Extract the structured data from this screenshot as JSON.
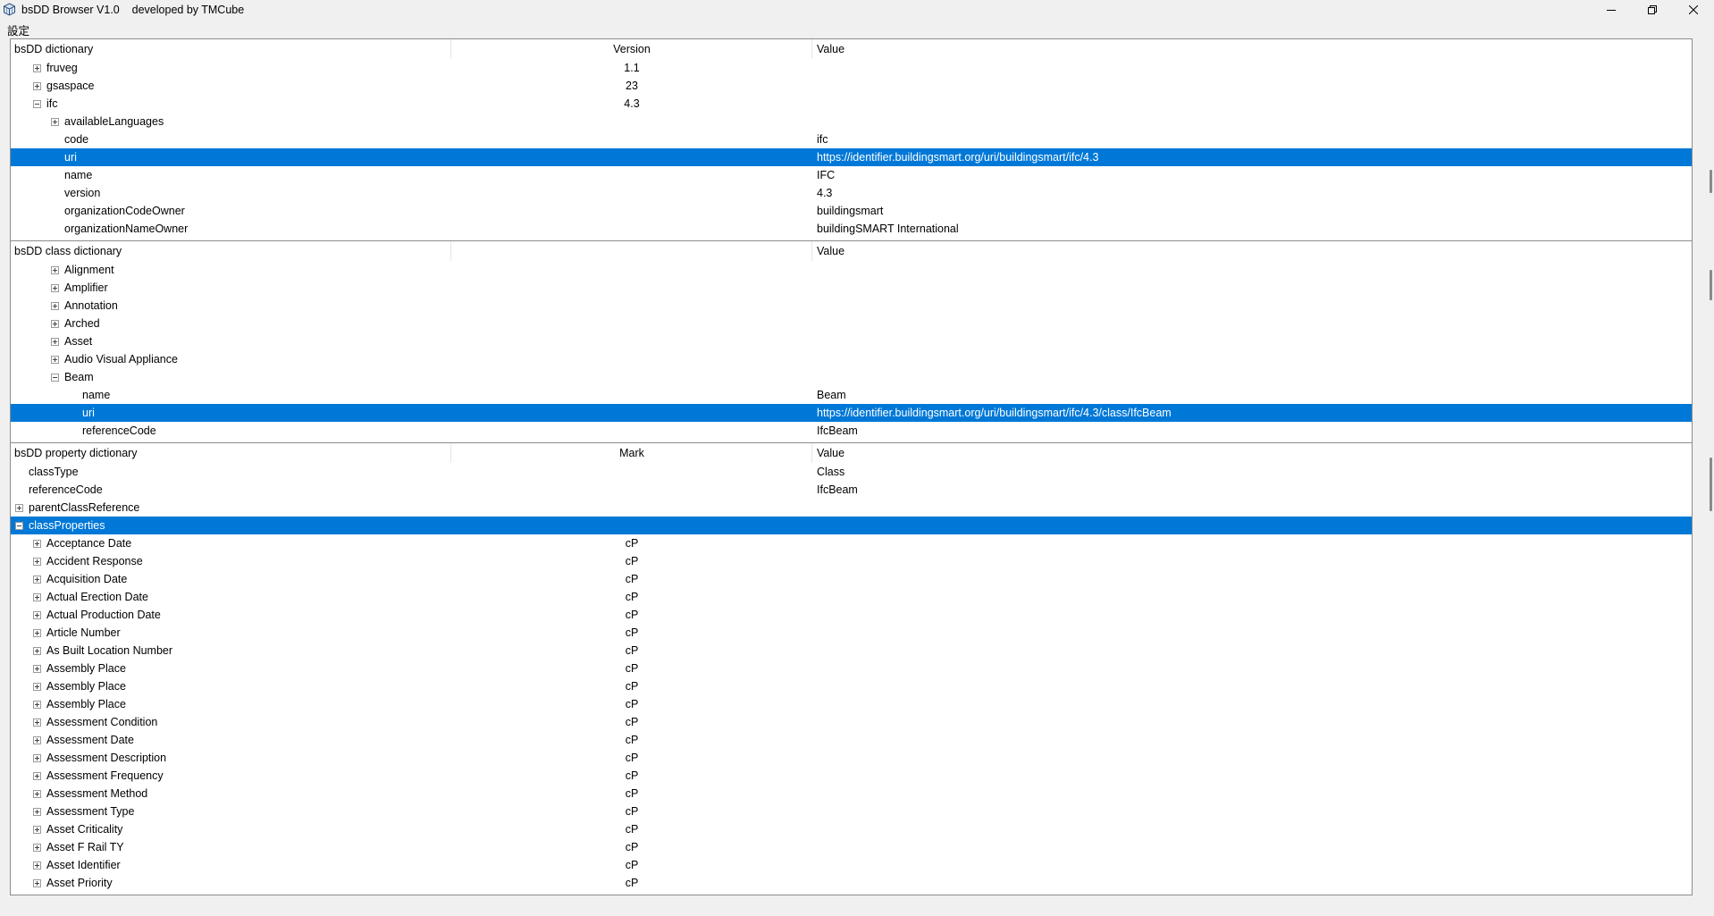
{
  "window": {
    "title": "bsDD Browser V1.0    developed by TMCube",
    "minimize": "─",
    "restore": "⧉",
    "close": "✕"
  },
  "menu": {
    "settings": "設定"
  },
  "dictionary_panel": {
    "headers": [
      "bsDD dictionary",
      "Version",
      "Value"
    ],
    "rows": [
      {
        "label": "fruveg",
        "mid": "1.1",
        "value": "",
        "level": 1,
        "expander": "plus",
        "selected": false
      },
      {
        "label": "gsaspace",
        "mid": "23",
        "value": "",
        "level": 1,
        "expander": "plus",
        "selected": false
      },
      {
        "label": "ifc",
        "mid": "4.3",
        "value": "",
        "level": 1,
        "expander": "minus",
        "selected": false
      },
      {
        "label": "availableLanguages",
        "mid": "",
        "value": "",
        "level": 2,
        "expander": "plus",
        "selected": false
      },
      {
        "label": "code",
        "mid": "",
        "value": "ifc",
        "level": 2,
        "expander": "none",
        "selected": false
      },
      {
        "label": "uri",
        "mid": "",
        "value": "https://identifier.buildingsmart.org/uri/buildingsmart/ifc/4.3",
        "level": 2,
        "expander": "none",
        "selected": true
      },
      {
        "label": "name",
        "mid": "",
        "value": "IFC",
        "level": 2,
        "expander": "none",
        "selected": false
      },
      {
        "label": "version",
        "mid": "",
        "value": "4.3",
        "level": 2,
        "expander": "none",
        "selected": false
      },
      {
        "label": "organizationCodeOwner",
        "mid": "",
        "value": "buildingsmart",
        "level": 2,
        "expander": "none",
        "selected": false
      },
      {
        "label": "organizationNameOwner",
        "mid": "",
        "value": "buildingSMART International",
        "level": 2,
        "expander": "none",
        "selected": false
      }
    ]
  },
  "class_panel": {
    "headers": [
      "bsDD class dictionary",
      "",
      "Value"
    ],
    "rows": [
      {
        "label": "Alignment",
        "mid": "",
        "value": "",
        "level": 2,
        "expander": "plus",
        "selected": false
      },
      {
        "label": "Amplifier",
        "mid": "",
        "value": "",
        "level": 2,
        "expander": "plus",
        "selected": false
      },
      {
        "label": "Annotation",
        "mid": "",
        "value": "",
        "level": 2,
        "expander": "plus",
        "selected": false
      },
      {
        "label": "Arched",
        "mid": "",
        "value": "",
        "level": 2,
        "expander": "plus",
        "selected": false
      },
      {
        "label": "Asset",
        "mid": "",
        "value": "",
        "level": 2,
        "expander": "plus",
        "selected": false
      },
      {
        "label": "Audio Visual Appliance",
        "mid": "",
        "value": "",
        "level": 2,
        "expander": "plus",
        "selected": false
      },
      {
        "label": "Beam",
        "mid": "",
        "value": "",
        "level": 2,
        "expander": "minus",
        "selected": false
      },
      {
        "label": "name",
        "mid": "",
        "value": "Beam",
        "level": 3,
        "expander": "none",
        "selected": false
      },
      {
        "label": "uri",
        "mid": "",
        "value": "https://identifier.buildingsmart.org/uri/buildingsmart/ifc/4.3/class/IfcBeam",
        "level": 3,
        "expander": "none",
        "selected": true
      },
      {
        "label": "referenceCode",
        "mid": "",
        "value": "IfcBeam",
        "level": 3,
        "expander": "none",
        "selected": false
      }
    ]
  },
  "property_panel": {
    "headers": [
      "bsDD property dictionary",
      "Mark",
      "Value"
    ],
    "rows": [
      {
        "label": "classType",
        "mid": "",
        "value": "Class",
        "level": 0,
        "expander": "none",
        "selected": false
      },
      {
        "label": "referenceCode",
        "mid": "",
        "value": "IfcBeam",
        "level": 0,
        "expander": "none",
        "selected": false
      },
      {
        "label": "parentClassReference",
        "mid": "",
        "value": "",
        "level": 0,
        "expander": "plus",
        "selected": false
      },
      {
        "label": "classProperties",
        "mid": "",
        "value": "",
        "level": 0,
        "expander": "minus",
        "selected": true
      },
      {
        "label": "Acceptance Date",
        "mid": "cP",
        "value": "",
        "level": 1,
        "expander": "plus",
        "selected": false
      },
      {
        "label": "Accident Response",
        "mid": "cP",
        "value": "",
        "level": 1,
        "expander": "plus",
        "selected": false
      },
      {
        "label": "Acquisition Date",
        "mid": "cP",
        "value": "",
        "level": 1,
        "expander": "plus",
        "selected": false
      },
      {
        "label": "Actual Erection Date",
        "mid": "cP",
        "value": "",
        "level": 1,
        "expander": "plus",
        "selected": false
      },
      {
        "label": "Actual Production Date",
        "mid": "cP",
        "value": "",
        "level": 1,
        "expander": "plus",
        "selected": false
      },
      {
        "label": "Article Number",
        "mid": "cP",
        "value": "",
        "level": 1,
        "expander": "plus",
        "selected": false
      },
      {
        "label": "As Built Location Number",
        "mid": "cP",
        "value": "",
        "level": 1,
        "expander": "plus",
        "selected": false
      },
      {
        "label": "Assembly Place",
        "mid": "cP",
        "value": "",
        "level": 1,
        "expander": "plus",
        "selected": false
      },
      {
        "label": "Assembly Place",
        "mid": "cP",
        "value": "",
        "level": 1,
        "expander": "plus",
        "selected": false
      },
      {
        "label": "Assembly Place",
        "mid": "cP",
        "value": "",
        "level": 1,
        "expander": "plus",
        "selected": false
      },
      {
        "label": "Assessment Condition",
        "mid": "cP",
        "value": "",
        "level": 1,
        "expander": "plus",
        "selected": false
      },
      {
        "label": "Assessment Date",
        "mid": "cP",
        "value": "",
        "level": 1,
        "expander": "plus",
        "selected": false
      },
      {
        "label": "Assessment Description",
        "mid": "cP",
        "value": "",
        "level": 1,
        "expander": "plus",
        "selected": false
      },
      {
        "label": "Assessment Frequency",
        "mid": "cP",
        "value": "",
        "level": 1,
        "expander": "plus",
        "selected": false
      },
      {
        "label": "Assessment Method",
        "mid": "cP",
        "value": "",
        "level": 1,
        "expander": "plus",
        "selected": false
      },
      {
        "label": "Assessment Type",
        "mid": "cP",
        "value": "",
        "level": 1,
        "expander": "plus",
        "selected": false
      },
      {
        "label": "Asset Criticality",
        "mid": "cP",
        "value": "",
        "level": 1,
        "expander": "plus",
        "selected": false
      },
      {
        "label": "Asset F Rail TY",
        "mid": "cP",
        "value": "",
        "level": 1,
        "expander": "plus",
        "selected": false
      },
      {
        "label": "Asset Identifier",
        "mid": "cP",
        "value": "",
        "level": 1,
        "expander": "plus",
        "selected": false
      },
      {
        "label": "Asset Priority",
        "mid": "cP",
        "value": "",
        "level": 1,
        "expander": "plus",
        "selected": false
      }
    ]
  }
}
